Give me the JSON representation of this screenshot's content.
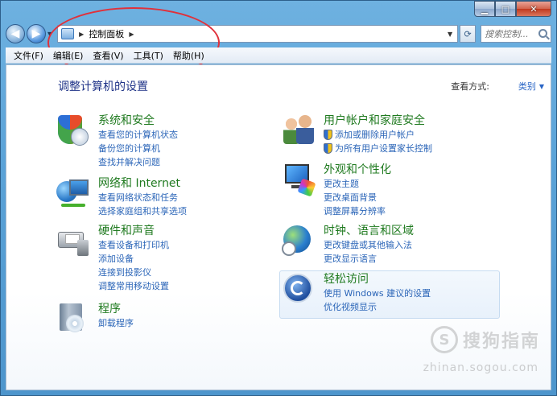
{
  "window": {
    "min_symbol": "▁",
    "max_symbol": "□",
    "close_symbol": "✕"
  },
  "address": {
    "path_item": "控制面板",
    "search_placeholder": "搜索控制...",
    "icon": "control-panel-icon"
  },
  "menu": [
    "文件(F)",
    "编辑(E)",
    "查看(V)",
    "工具(T)",
    "帮助(H)"
  ],
  "page": {
    "heading": "调整计算机的设置",
    "view_by_label": "查看方式:",
    "view_by_value": "类别"
  },
  "categories": {
    "security": {
      "title": "系统和安全",
      "links": [
        "查看您的计算机状态",
        "备份您的计算机",
        "查找并解决问题"
      ],
      "icon": "shield-icon"
    },
    "network": {
      "title": "网络和 Internet",
      "links": [
        "查看网络状态和任务",
        "选择家庭组和共享选项"
      ],
      "icon": "network-icon"
    },
    "hardware": {
      "title": "硬件和声音",
      "links": [
        "查看设备和打印机",
        "添加设备",
        "连接到投影仪",
        "调整常用移动设置"
      ],
      "icon": "printer-icon"
    },
    "programs": {
      "title": "程序",
      "links": [
        "卸载程序"
      ],
      "icon": "programs-icon"
    },
    "users": {
      "title": "用户帐户和家庭安全",
      "links": [
        "添加或删除用户帐户",
        "为所有用户设置家长控制"
      ],
      "icon": "users-icon"
    },
    "appearance": {
      "title": "外观和个性化",
      "links": [
        "更改主题",
        "更改桌面背景",
        "调整屏幕分辨率"
      ],
      "icon": "monitor-icon"
    },
    "clock": {
      "title": "时钟、语言和区域",
      "links": [
        "更改键盘或其他输入法",
        "更改显示语言"
      ],
      "icon": "clock-globe-icon"
    },
    "ease": {
      "title": "轻松访问",
      "links": [
        "使用 Windows 建议的设置",
        "优化视频显示"
      ],
      "icon": "ease-of-access-icon"
    }
  },
  "watermark": {
    "logo_char": "S",
    "text": "搜狗指南",
    "url": "zhinan.sogou.com"
  },
  "colors": {
    "category_title": "#1f7a1f",
    "link": "#2c66b8",
    "heading": "#1e3287",
    "annotation": "#e0313b"
  }
}
